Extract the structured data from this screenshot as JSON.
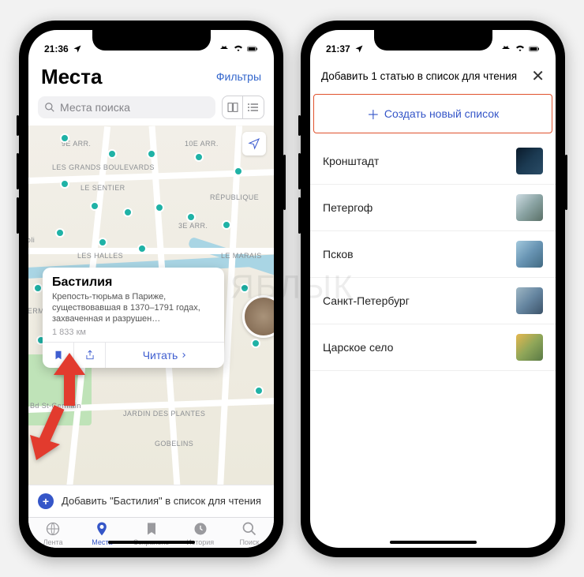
{
  "statusbar": {
    "time_left": "21:36",
    "time_right": "21:37"
  },
  "left": {
    "title": "Места",
    "filters": "Фильтры",
    "search_placeholder": "Места поиска",
    "map_labels": {
      "a": "9E ARR.",
      "b": "10E ARR.",
      "c": "LES GRANDS BOULEVARDS",
      "d": "LE SENTIER",
      "e": "RÉPUBLIQUE",
      "f": "3E ARR.",
      "g": "LES HALLES",
      "h": "LE MARAIS",
      "i": "SAINT-GERMAIN-DES-PRÉS",
      "j": "Bd St-Germain",
      "k": "GOBELINS",
      "l": "JARDIN DES PLANTES",
      "m": "de Rivoli"
    },
    "card": {
      "title": "Бастилия",
      "desc": "Крепость-тюрьма в Париже, существовавшая в 1370–1791 годах, захваченная и разрушен…",
      "distance": "1 833 км",
      "read": "Читать"
    },
    "add_banner": "Добавить \"Бастилия\" в список для чтения",
    "tabs": {
      "feed": "Лента",
      "places": "Места",
      "saved": "Сохранено",
      "history": "История",
      "search": "Поиск"
    }
  },
  "right": {
    "header": "Добавить 1 статью в список для чтения",
    "create": "Создать новый список",
    "items": {
      "0": "Кронштадт",
      "1": "Петергоф",
      "2": "Псков",
      "3": "Санкт-Петербург",
      "4": "Царское село"
    }
  },
  "watermark": "ЯБЛЫК"
}
